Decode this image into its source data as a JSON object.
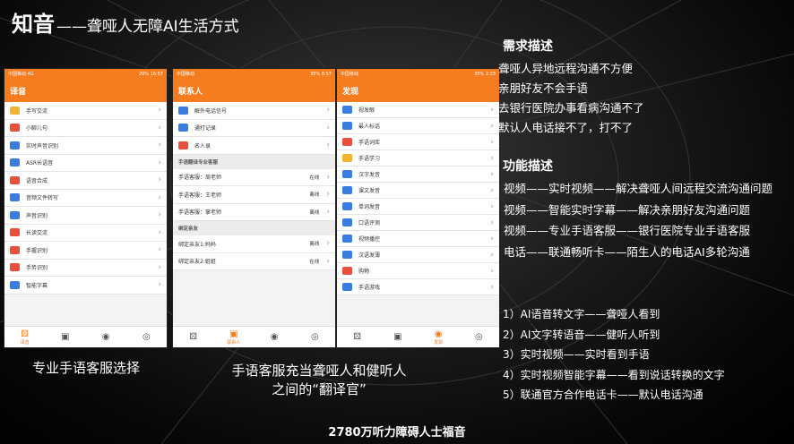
{
  "slide": {
    "title_bold": "知音",
    "title_rest": "——聋哑人无障AI生活方式",
    "footer": "2780万听力障碍人士福音"
  },
  "phone1": {
    "status_left": "中国移动 4G",
    "status_right": "29% 16:57",
    "header": "译音",
    "items": [
      {
        "label": "手写交流",
        "icon_color": "#f2b233"
      },
      {
        "label": "小聊儿句",
        "icon_color": "#e94f3d"
      },
      {
        "label": "实时声音识别",
        "icon_color": "#3a7de0"
      },
      {
        "label": "ASR长语音",
        "icon_color": "#3a7de0"
      },
      {
        "label": "语音合成",
        "icon_color": "#e94f3d"
      },
      {
        "label": "音频文件转写",
        "icon_color": "#3a7de0"
      },
      {
        "label": "声音识别",
        "icon_color": "#3a7de0"
      },
      {
        "label": "长读交流",
        "icon_color": "#e94f3d"
      },
      {
        "label": "手握识别",
        "icon_color": "#e94f3d"
      },
      {
        "label": "手势识别",
        "icon_color": "#e94f3d"
      },
      {
        "label": "智能字幕",
        "icon_color": "#3a7de0"
      }
    ],
    "tabs": [
      {
        "icon": "ear-icon",
        "label": "译音",
        "active": true
      },
      {
        "icon": "chat-icon",
        "label": ""
      },
      {
        "icon": "compass-icon",
        "label": ""
      },
      {
        "icon": "profile-icon",
        "label": ""
      }
    ]
  },
  "phone2": {
    "status_left": "中国移动",
    "status_right": "35% 8:57",
    "header": "联系人",
    "top_items": [
      {
        "label": "解外电话信号",
        "icon_color": "#3a7de0"
      },
      {
        "label": "通打记录",
        "icon_color": "#3a7de0"
      },
      {
        "label": "名人录",
        "icon_color": "#e94f3d"
      }
    ],
    "section1": "手语翻译专业客服",
    "agents": [
      {
        "label": "手语客服：周老师",
        "status": "在线"
      },
      {
        "label": "手语客服：王老师",
        "status": "离线"
      },
      {
        "label": "手语客服：掌老师",
        "status": "离线"
      }
    ],
    "section2": "绑定亲友",
    "friends": [
      {
        "label": "绑定亲友1:妈妈",
        "status": "离线"
      },
      {
        "label": "绑定亲友2:姐姐",
        "status": "在线"
      }
    ],
    "tabs": [
      {
        "icon": "ear-icon",
        "label": ""
      },
      {
        "icon": "chat-icon",
        "label": "联系人",
        "active": true
      },
      {
        "icon": "compass-icon",
        "label": ""
      },
      {
        "icon": "profile-icon",
        "label": ""
      }
    ]
  },
  "phone3": {
    "status_left": "中国移动",
    "status_right": "35% 2:23",
    "header": "发现",
    "items": [
      {
        "label": "视发眼",
        "icon_color": "#3a7de0"
      },
      {
        "label": "最人标话",
        "icon_color": "#3a7de0"
      },
      {
        "label": "手语词库",
        "icon_color": "#e94f3d"
      },
      {
        "label": "手语学习",
        "icon_color": "#f2b233"
      },
      {
        "label": "汉字发音",
        "icon_color": "#3a7de0"
      },
      {
        "label": "课文发音",
        "icon_color": "#3a7de0"
      },
      {
        "label": "单词发音",
        "icon_color": "#3a7de0"
      },
      {
        "label": "口语评测",
        "icon_color": "#3a7de0"
      },
      {
        "label": "视频播控",
        "icon_color": "#3a7de0"
      },
      {
        "label": "汉语发薄",
        "icon_color": "#3a7de0"
      },
      {
        "label": "购物",
        "icon_color": "#e94f3d"
      },
      {
        "label": "手语游戏",
        "icon_color": "#3a7de0"
      }
    ],
    "tabs": [
      {
        "icon": "ear-icon",
        "label": ""
      },
      {
        "icon": "chat-icon",
        "label": ""
      },
      {
        "icon": "compass-icon",
        "label": "发现",
        "active": true
      },
      {
        "icon": "profile-icon",
        "label": ""
      }
    ]
  },
  "captions": {
    "c1": "专业手语客服选择",
    "c2a": "手语客服充当聋哑人和健听人",
    "c2b": "之间的“翻译官”"
  },
  "needs": {
    "heading": "需求描述",
    "lines": [
      "聋哑人异地远程沟通不方便",
      "亲朋好友不会手语",
      "去银行医院办事看病沟通不了",
      "默认人电话接不了，打不了"
    ]
  },
  "features": {
    "heading": "功能描述",
    "lines": [
      "视频——实时视频——解决聋哑人间远程交流沟通问题",
      "视频——智能实时字幕——解决亲朋好友沟通问题",
      "视频——专业手语客服——银行医院专业手语客服",
      "电话——联通畅听卡——陌生人的电话AI多轮沟通"
    ]
  },
  "numbered": [
    "1）AI语音转文字——聋哑人看到",
    "2）AI文字转语音——健听人听到",
    "3）实时视频——实时看到手语",
    "4）实时视频智能字幕——看到说话转换的文字",
    "5）联通官方合作电话卡——默认电话沟通"
  ]
}
